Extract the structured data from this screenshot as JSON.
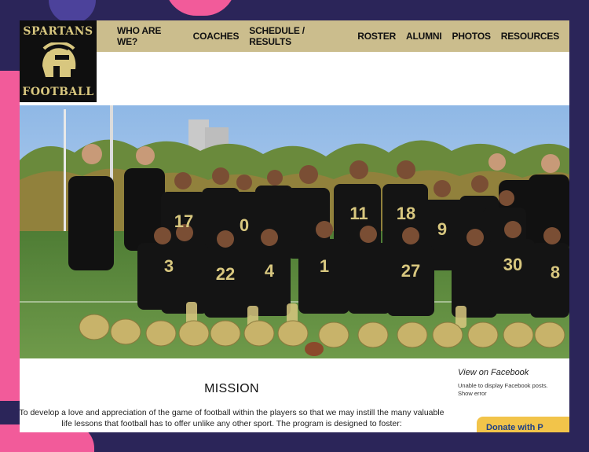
{
  "logo": {
    "line1": "SPARTANS",
    "line2": "FOOTBALL"
  },
  "nav": {
    "items": [
      "WHO ARE WE?",
      "COACHES",
      "SCHEDULE / RESULTS",
      "ROSTER",
      "ALUMNI",
      "PHOTOS",
      "RESOURCES"
    ]
  },
  "photo": {
    "jerseys": [
      "17",
      "0",
      "11",
      "18",
      "9",
      "3",
      "22",
      "4",
      "1",
      "27",
      "30",
      "8"
    ]
  },
  "mission": {
    "heading": "MISSION",
    "text": "To develop a love and appreciation of the game of football within the players so that we may instill the many valuable life lessons that football has to offer unlike any other sport. The program is designed to foster:"
  },
  "facebook": {
    "title": "View on Facebook",
    "error_line1": "Unable to display Facebook posts.",
    "error_line2": "Show error"
  },
  "donate": {
    "label": "Donate with P"
  },
  "colors": {
    "nav_bg": "#cbbd8d",
    "logo_gold": "#d8c77f",
    "page_bg": "#2b2559",
    "accent_pink": "#f25b9a"
  }
}
